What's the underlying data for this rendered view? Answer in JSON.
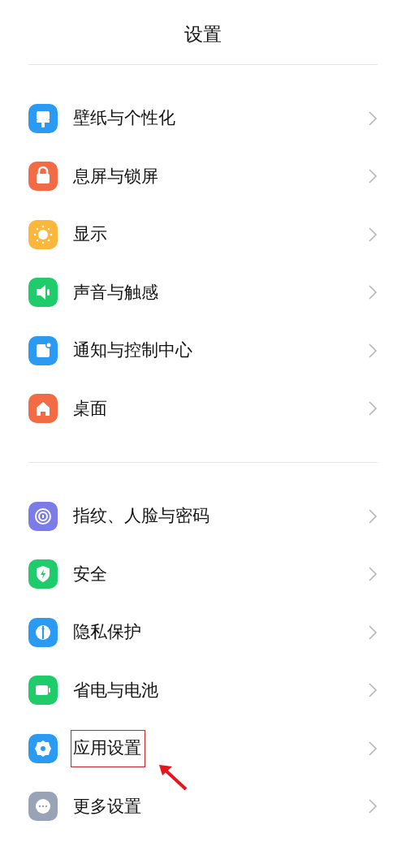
{
  "header": {
    "title": "设置"
  },
  "groups": [
    {
      "items": [
        {
          "label": "壁纸与个性化",
          "color": "#2b9af3",
          "highlighted": false
        },
        {
          "label": "息屏与锁屏",
          "color": "#f26b45",
          "highlighted": false
        },
        {
          "label": "显示",
          "color": "#fbb73c",
          "highlighted": false
        },
        {
          "label": "声音与触感",
          "color": "#1fcb6a",
          "highlighted": false
        },
        {
          "label": "通知与控制中心",
          "color": "#2b9af3",
          "highlighted": false
        },
        {
          "label": "桌面",
          "color": "#f26b45",
          "highlighted": false
        }
      ]
    },
    {
      "items": [
        {
          "label": "指纹、人脸与密码",
          "color": "#7c7ce8",
          "highlighted": false
        },
        {
          "label": "安全",
          "color": "#1fcb6a",
          "highlighted": false
        },
        {
          "label": "隐私保护",
          "color": "#2b9af3",
          "highlighted": false
        },
        {
          "label": "省电与电池",
          "color": "#1fcb6a",
          "highlighted": false
        },
        {
          "label": "应用设置",
          "color": "#2b9af3",
          "highlighted": true
        },
        {
          "label": "更多设置",
          "color": "#98a4b5",
          "highlighted": false
        }
      ]
    }
  ]
}
